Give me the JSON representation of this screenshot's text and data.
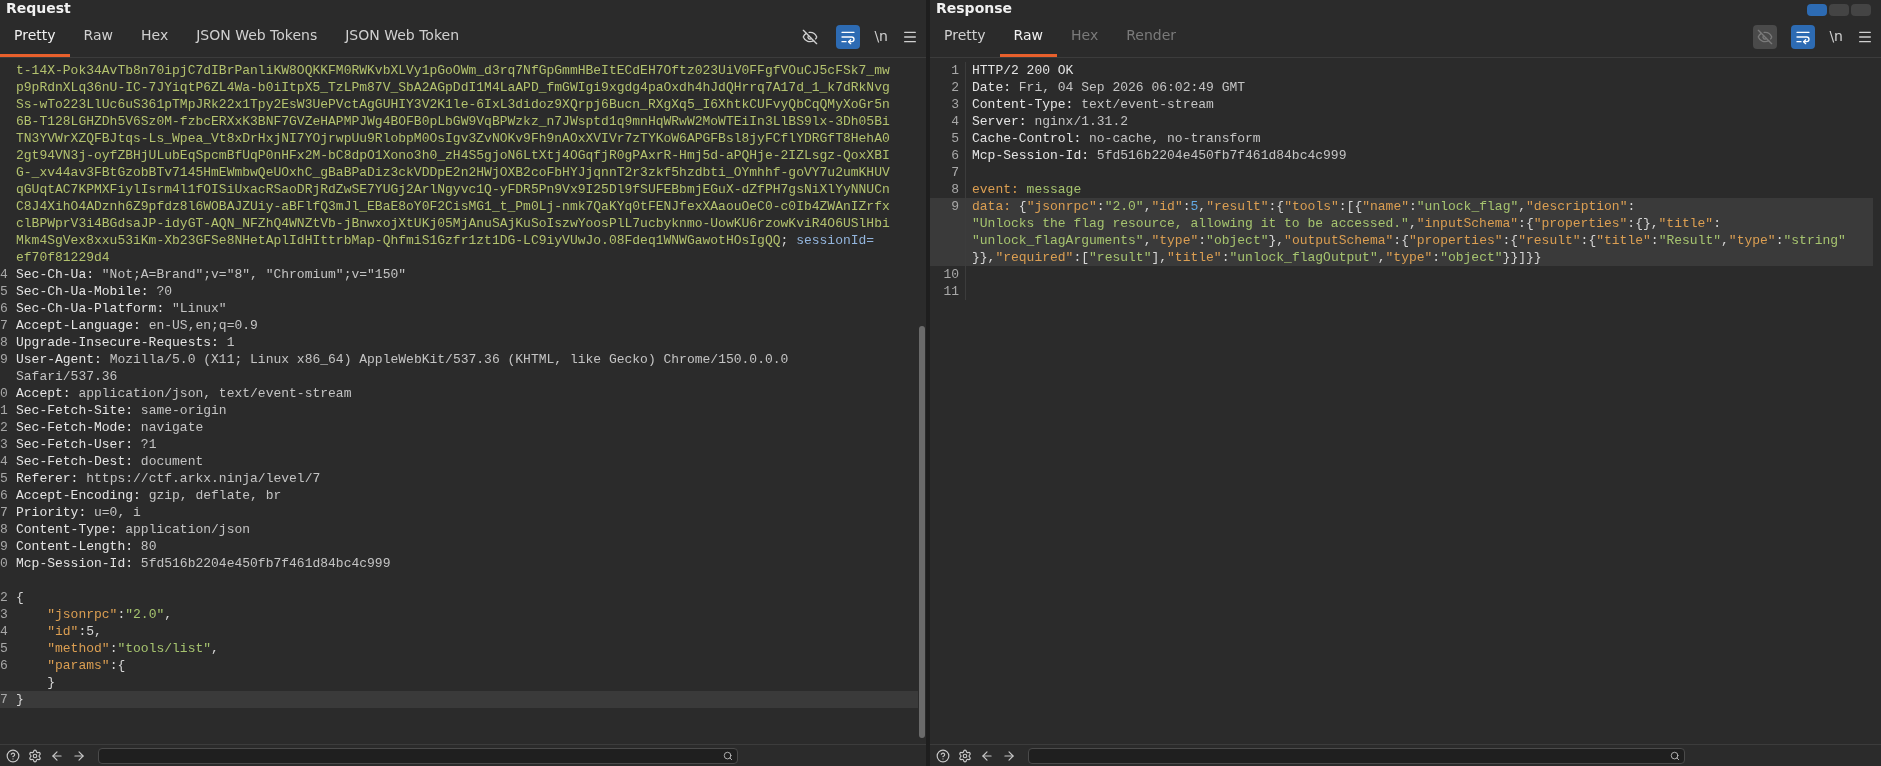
{
  "request": {
    "title": "Request",
    "tabs": [
      {
        "label": "Pretty",
        "selected": true,
        "disabled": false
      },
      {
        "label": "Raw",
        "selected": false,
        "disabled": false
      },
      {
        "label": "Hex",
        "selected": false,
        "disabled": false
      },
      {
        "label": "JSON Web Tokens",
        "selected": false,
        "disabled": false
      },
      {
        "label": "JSON Web Token",
        "selected": false,
        "disabled": false
      }
    ],
    "newline_label": "\\n",
    "hide_disabled": false,
    "lines": [
      {
        "highlighted": false,
        "rows": [
          {
            "segments": [
              {
                "kind": "cookie",
                "text": "t-14X-Pok34AvTb8n70ipjC7dIBrPanliKW8OQKKFM0RWKvbXLVy1pGoOWm_d3rq7NfGpGmmHBeItECdEH7Oftz023UiV0FFgfVOuCJ5cFSk7_mw"
              }
            ]
          },
          {
            "segments": [
              {
                "kind": "cookie",
                "text": "p9pRdnXLq36nU-IC-7JYiqtP6ZL4Wa-b0iItpX5_TzLPm87V_SbA2AGpDdI1M4LaAPD_fmGWIgi9xgdg4paOxdh4hJdQHrrq7A17d_1_k7dRkNvg"
              }
            ]
          },
          {
            "segments": [
              {
                "kind": "cookie",
                "text": "Ss-wTo223LlUc6uS361pTMpJRk22x1Tpy2EsW3UePVctAgGUHIY3V2K1le-6IxL3didoz9XQrpj6Bucn_RXgXq5_I6XhtkCUFvyQbCqQMyXoGr5n"
              }
            ]
          },
          {
            "segments": [
              {
                "kind": "cookie",
                "text": "6B-T128LGHZDh5V6Sz0M-fzbcERXxK3BNF7GVZeHAPMPJWg4BOFB0pLbGW9VqBPWzkz_n7JWsptd1q9mnHqWRwW2MoWTEiIn3LlBS9lx-3Dh05Bi"
              }
            ]
          },
          {
            "segments": [
              {
                "kind": "cookie",
                "text": "TN3YVWrXZQFBJtqs-Ls_Wpea_Vt8xDrHxjNI7YOjrwpUu9RlobpM0OsIgv3ZvNOKv9Fh9nAOxXVIVr7zTYKoW6APGFBsl8jyFCflYDRGfT8HehA0"
              }
            ]
          },
          {
            "segments": [
              {
                "kind": "cookie",
                "text": "2gt94VN3j-oyfZBHjULubEqSpcmBfUqP0nHFx2M-bC8dpO1Xono3h0_zH4S5gjoN6LtXtj4OGqfjR0gPAxrR-Hmj5d-aPQHje-2IZLsgz-QoxXBI"
              }
            ]
          },
          {
            "segments": [
              {
                "kind": "cookie",
                "text": "G-_xv44av3FBtGzobBTv7145HmEWmbwQeUOxhC_gBaBPaDiz3ckVDDpE2n2HWjOXB2coFbHYJjqnnT2r3zkf5hzdbti_OYmhhf-goVY7u2umKHUV"
              }
            ]
          },
          {
            "segments": [
              {
                "kind": "cookie",
                "text": "qGUqtAC7KPMXFiylIsrm4l1fOISiUxacRSaoDRjRdZwSE7YUGj2ArlNgyvc1Q-yFDR5Pn9Vx9I25Dl9fSUFEBbmjEGuX-dZfPH7gsNiXlYyNNUCn"
              }
            ]
          },
          {
            "segments": [
              {
                "kind": "cookie",
                "text": "C8J4XihO4ADznh6Z9pfdz8l6WOBAJZUiy-aBFlfQ3mJl_EBaE8oY0F2CisMG1_t_Pm0Lj-nmk7QaKYq0tFENJfexXAaouOeC0-c0Ib4ZWAnIZrfx"
              }
            ]
          },
          {
            "segments": [
              {
                "kind": "cookie",
                "text": "clBPWprV3i4BGdsaJP-idyGT-AQN_NFZhQ4WNZtVb-jBnwxojXtUKj05MjAnuSAjKuSoIszwYoosPlL7ucbyknmo-UowKU6rzowKviR4O6USlHbi"
              }
            ]
          },
          {
            "segments": [
              {
                "kind": "cookie",
                "text": "Mkm4SgVex8xxu53iKm-Xb23GFSe8NHetAplIdHIttrbMap-QhfmiS1Gzfr1zt1DG-LC9iyVUwJo.08Fdeq1WNWGawotHOsIgQQ"
              },
              {
                "kind": "punct",
                "text": "; "
              },
              {
                "kind": "attr",
                "text": "sessionId="
              }
            ]
          },
          {
            "segments": [
              {
                "kind": "cookie",
                "text": "ef70f81229d4"
              }
            ]
          }
        ]
      },
      {
        "number": "4",
        "highlighted": false,
        "rows": [
          {
            "segments": [
              {
                "kind": "name",
                "text": "Sec-Ch-Ua:"
              },
              {
                "kind": "value",
                "text": " \"Not;A=Brand\";v=\"8\", \"Chromium\";v=\"150\""
              }
            ]
          }
        ]
      },
      {
        "number": "5",
        "highlighted": false,
        "rows": [
          {
            "segments": [
              {
                "kind": "name",
                "text": "Sec-Ch-Ua-Mobile:"
              },
              {
                "kind": "value",
                "text": " ?0"
              }
            ]
          }
        ]
      },
      {
        "number": "6",
        "highlighted": false,
        "rows": [
          {
            "segments": [
              {
                "kind": "name",
                "text": "Sec-Ch-Ua-Platform:"
              },
              {
                "kind": "value",
                "text": " \"Linux\""
              }
            ]
          }
        ]
      },
      {
        "number": "7",
        "highlighted": false,
        "rows": [
          {
            "segments": [
              {
                "kind": "name",
                "text": "Accept-Language:"
              },
              {
                "kind": "value",
                "text": " en-US,en;q=0.9"
              }
            ]
          }
        ]
      },
      {
        "number": "8",
        "highlighted": false,
        "rows": [
          {
            "segments": [
              {
                "kind": "name",
                "text": "Upgrade-Insecure-Requests:"
              },
              {
                "kind": "value",
                "text": " 1"
              }
            ]
          }
        ]
      },
      {
        "number": "9",
        "highlighted": false,
        "rows": [
          {
            "segments": [
              {
                "kind": "name",
                "text": "User-Agent:"
              },
              {
                "kind": "value",
                "text": " Mozilla/5.0 (X11; Linux x86_64) AppleWebKit/537.36 (KHTML, like Gecko) Chrome/150.0.0.0"
              }
            ]
          },
          {
            "segments": [
              {
                "kind": "value",
                "text": "Safari/537.36"
              }
            ]
          }
        ]
      },
      {
        "number": "0",
        "highlighted": false,
        "rows": [
          {
            "segments": [
              {
                "kind": "name",
                "text": "Accept:"
              },
              {
                "kind": "value",
                "text": " application/json, text/event-stream"
              }
            ]
          }
        ]
      },
      {
        "number": "1",
        "highlighted": false,
        "rows": [
          {
            "segments": [
              {
                "kind": "name",
                "text": "Sec-Fetch-Site:"
              },
              {
                "kind": "value",
                "text": " same-origin"
              }
            ]
          }
        ]
      },
      {
        "number": "2",
        "highlighted": false,
        "rows": [
          {
            "segments": [
              {
                "kind": "name",
                "text": "Sec-Fetch-Mode:"
              },
              {
                "kind": "value",
                "text": " navigate"
              }
            ]
          }
        ]
      },
      {
        "number": "3",
        "highlighted": false,
        "rows": [
          {
            "segments": [
              {
                "kind": "name",
                "text": "Sec-Fetch-User:"
              },
              {
                "kind": "value",
                "text": " ?1"
              }
            ]
          }
        ]
      },
      {
        "number": "4",
        "highlighted": false,
        "rows": [
          {
            "segments": [
              {
                "kind": "name",
                "text": "Sec-Fetch-Dest:"
              },
              {
                "kind": "value",
                "text": " document"
              }
            ]
          }
        ]
      },
      {
        "number": "5",
        "highlighted": false,
        "rows": [
          {
            "segments": [
              {
                "kind": "name",
                "text": "Referer:"
              },
              {
                "kind": "value",
                "text": " https://ctf.arkx.ninja/level/7"
              }
            ]
          }
        ]
      },
      {
        "number": "6",
        "highlighted": false,
        "rows": [
          {
            "segments": [
              {
                "kind": "name",
                "text": "Accept-Encoding:"
              },
              {
                "kind": "value",
                "text": " gzip, deflate, br"
              }
            ]
          }
        ]
      },
      {
        "number": "7",
        "highlighted": false,
        "rows": [
          {
            "segments": [
              {
                "kind": "name",
                "text": "Priority:"
              },
              {
                "kind": "value",
                "text": " u=0, i"
              }
            ]
          }
        ]
      },
      {
        "number": "8",
        "highlighted": false,
        "rows": [
          {
            "segments": [
              {
                "kind": "name",
                "text": "Content-Type:"
              },
              {
                "kind": "value",
                "text": " application/json"
              }
            ]
          }
        ]
      },
      {
        "number": "9",
        "highlighted": false,
        "rows": [
          {
            "segments": [
              {
                "kind": "name",
                "text": "Content-Length:"
              },
              {
                "kind": "value",
                "text": " 80"
              }
            ]
          }
        ]
      },
      {
        "number": "0",
        "highlighted": false,
        "rows": [
          {
            "segments": [
              {
                "kind": "name",
                "text": "Mcp-Session-Id:"
              },
              {
                "kind": "value",
                "text": " 5fd516b2204e450fb7f461d84bc4c999"
              }
            ]
          }
        ]
      },
      {
        "highlighted": false,
        "rows": [
          {}
        ]
      },
      {
        "number": "2",
        "highlighted": false,
        "rows": [
          {
            "segments": [
              {
                "kind": "punct",
                "text": "{"
              }
            ]
          }
        ]
      },
      {
        "number": "3",
        "highlighted": false,
        "rows": [
          {
            "segments": [
              {
                "kind": "key",
                "text": "    \"jsonrpc\""
              },
              {
                "kind": "punct",
                "text": ":"
              },
              {
                "kind": "string",
                "text": "\"2.0\""
              },
              {
                "kind": "punct",
                "text": ","
              }
            ]
          }
        ]
      },
      {
        "number": "4",
        "highlighted": false,
        "rows": [
          {
            "segments": [
              {
                "kind": "key",
                "text": "    \"id\""
              },
              {
                "kind": "punct",
                "text": ":5,"
              }
            ]
          }
        ]
      },
      {
        "number": "5",
        "highlighted": false,
        "rows": [
          {
            "segments": [
              {
                "kind": "key",
                "text": "    \"method\""
              },
              {
                "kind": "punct",
                "text": ":"
              },
              {
                "kind": "string",
                "text": "\"tools/list\""
              },
              {
                "kind": "punct",
                "text": ","
              }
            ]
          }
        ]
      },
      {
        "number": "6",
        "highlighted": false,
        "rows": [
          {
            "segments": [
              {
                "kind": "key",
                "text": "    \"params\""
              },
              {
                "kind": "punct",
                "text": ":{"
              }
            ]
          },
          {
            "segments": [
              {
                "kind": "punct",
                "text": "    }"
              }
            ]
          }
        ]
      },
      {
        "number": "7",
        "highlighted": true,
        "rows": [
          {
            "segments": [
              {
                "kind": "punct",
                "text": "}"
              }
            ]
          }
        ]
      }
    ]
  },
  "response": {
    "title": "Response",
    "tabs": [
      {
        "label": "Pretty",
        "selected": false,
        "disabled": false
      },
      {
        "label": "Raw",
        "selected": true,
        "disabled": false
      },
      {
        "label": "Hex",
        "selected": false,
        "disabled": true
      },
      {
        "label": "Render",
        "selected": false,
        "disabled": true
      }
    ],
    "newline_label": "\\n",
    "hide_disabled": true,
    "lines": [
      {
        "number": "1",
        "highlighted": false,
        "rows": [
          {
            "segments": [
              {
                "kind": "name",
                "text": "HTTP/2 200 OK"
              }
            ]
          }
        ]
      },
      {
        "number": "2",
        "highlighted": false,
        "rows": [
          {
            "segments": [
              {
                "kind": "name",
                "text": "Date:"
              },
              {
                "kind": "value",
                "text": " Fri, 04 Sep 2026 06:02:49 GMT"
              }
            ]
          }
        ]
      },
      {
        "number": "3",
        "highlighted": false,
        "rows": [
          {
            "segments": [
              {
                "kind": "name",
                "text": "Content-Type:"
              },
              {
                "kind": "value",
                "text": " text/event-stream"
              }
            ]
          }
        ]
      },
      {
        "number": "4",
        "highlighted": false,
        "rows": [
          {
            "segments": [
              {
                "kind": "name",
                "text": "Server:"
              },
              {
                "kind": "value",
                "text": " nginx/1.31.2"
              }
            ]
          }
        ]
      },
      {
        "number": "5",
        "highlighted": false,
        "rows": [
          {
            "segments": [
              {
                "kind": "name",
                "text": "Cache-Control:"
              },
              {
                "kind": "value",
                "text": " no-cache, no-transform"
              }
            ]
          }
        ]
      },
      {
        "number": "6",
        "highlighted": false,
        "rows": [
          {
            "segments": [
              {
                "kind": "name",
                "text": "Mcp-Session-Id:"
              },
              {
                "kind": "value",
                "text": " 5fd516b2204e450fb7f461d84bc4c999"
              }
            ]
          }
        ]
      },
      {
        "number": "7",
        "highlighted": false,
        "rows": [
          {}
        ]
      },
      {
        "number": "8",
        "highlighted": false,
        "rows": [
          {
            "segments": [
              {
                "kind": "key",
                "text": "event:"
              },
              {
                "kind": "string",
                "text": " message"
              }
            ]
          }
        ]
      },
      {
        "number": "9",
        "highlighted": true,
        "rows": [
          {
            "segments": [
              {
                "kind": "key",
                "text": "data:"
              },
              {
                "kind": "punct",
                "text": " {"
              },
              {
                "kind": "key",
                "text": "\"jsonrpc\""
              },
              {
                "kind": "punct",
                "text": ":"
              },
              {
                "kind": "string",
                "text": "\"2.0\""
              },
              {
                "kind": "punct",
                "text": ","
              },
              {
                "kind": "key",
                "text": "\"id\""
              },
              {
                "kind": "punct",
                "text": ":"
              },
              {
                "kind": "number",
                "text": "5"
              },
              {
                "kind": "punct",
                "text": ","
              },
              {
                "kind": "key",
                "text": "\"result\""
              },
              {
                "kind": "punct",
                "text": ":{"
              },
              {
                "kind": "key",
                "text": "\"tools\""
              },
              {
                "kind": "punct",
                "text": ":[{"
              },
              {
                "kind": "key",
                "text": "\"name\""
              },
              {
                "kind": "punct",
                "text": ":"
              },
              {
                "kind": "string",
                "text": "\"unlock_flag\""
              },
              {
                "kind": "punct",
                "text": ","
              },
              {
                "kind": "key",
                "text": "\"description\""
              },
              {
                "kind": "punct",
                "text": ":"
              }
            ]
          },
          {
            "segments": [
              {
                "kind": "string",
                "text": "\"Unlocks the flag resource, allowing it to be accessed.\""
              },
              {
                "kind": "punct",
                "text": ","
              },
              {
                "kind": "key",
                "text": "\"inputSchema\""
              },
              {
                "kind": "punct",
                "text": ":{"
              },
              {
                "kind": "key",
                "text": "\"properties\""
              },
              {
                "kind": "punct",
                "text": ":{},"
              },
              {
                "kind": "key",
                "text": "\"title\""
              },
              {
                "kind": "punct",
                "text": ":"
              }
            ]
          },
          {
            "segments": [
              {
                "kind": "string",
                "text": "\"unlock_flagArguments\""
              },
              {
                "kind": "punct",
                "text": ","
              },
              {
                "kind": "key",
                "text": "\"type\""
              },
              {
                "kind": "punct",
                "text": ":"
              },
              {
                "kind": "string",
                "text": "\"object\""
              },
              {
                "kind": "punct",
                "text": "},"
              },
              {
                "kind": "key",
                "text": "\"outputSchema\""
              },
              {
                "kind": "punct",
                "text": ":{"
              },
              {
                "kind": "key",
                "text": "\"properties\""
              },
              {
                "kind": "punct",
                "text": ":{"
              },
              {
                "kind": "key",
                "text": "\"result\""
              },
              {
                "kind": "punct",
                "text": ":{"
              },
              {
                "kind": "key",
                "text": "\"title\""
              },
              {
                "kind": "punct",
                "text": ":"
              },
              {
                "kind": "string",
                "text": "\"Result\""
              },
              {
                "kind": "punct",
                "text": ","
              },
              {
                "kind": "key",
                "text": "\"type\""
              },
              {
                "kind": "punct",
                "text": ":"
              },
              {
                "kind": "string",
                "text": "\"string\""
              }
            ]
          },
          {
            "segments": [
              {
                "kind": "punct",
                "text": "}},"
              },
              {
                "kind": "key",
                "text": "\"required\""
              },
              {
                "kind": "punct",
                "text": ":["
              },
              {
                "kind": "string",
                "text": "\"result\""
              },
              {
                "kind": "punct",
                "text": "],"
              },
              {
                "kind": "key",
                "text": "\"title\""
              },
              {
                "kind": "punct",
                "text": ":"
              },
              {
                "kind": "string",
                "text": "\"unlock_flagOutput\""
              },
              {
                "kind": "punct",
                "text": ","
              },
              {
                "kind": "key",
                "text": "\"type\""
              },
              {
                "kind": "punct",
                "text": ":"
              },
              {
                "kind": "string",
                "text": "\"object\""
              },
              {
                "kind": "punct",
                "text": "}}]}}"
              }
            ]
          }
        ]
      },
      {
        "number": "10",
        "highlighted": false,
        "rows": [
          {}
        ]
      },
      {
        "number": "11",
        "highlighted": false,
        "rows": [
          {}
        ]
      }
    ]
  }
}
